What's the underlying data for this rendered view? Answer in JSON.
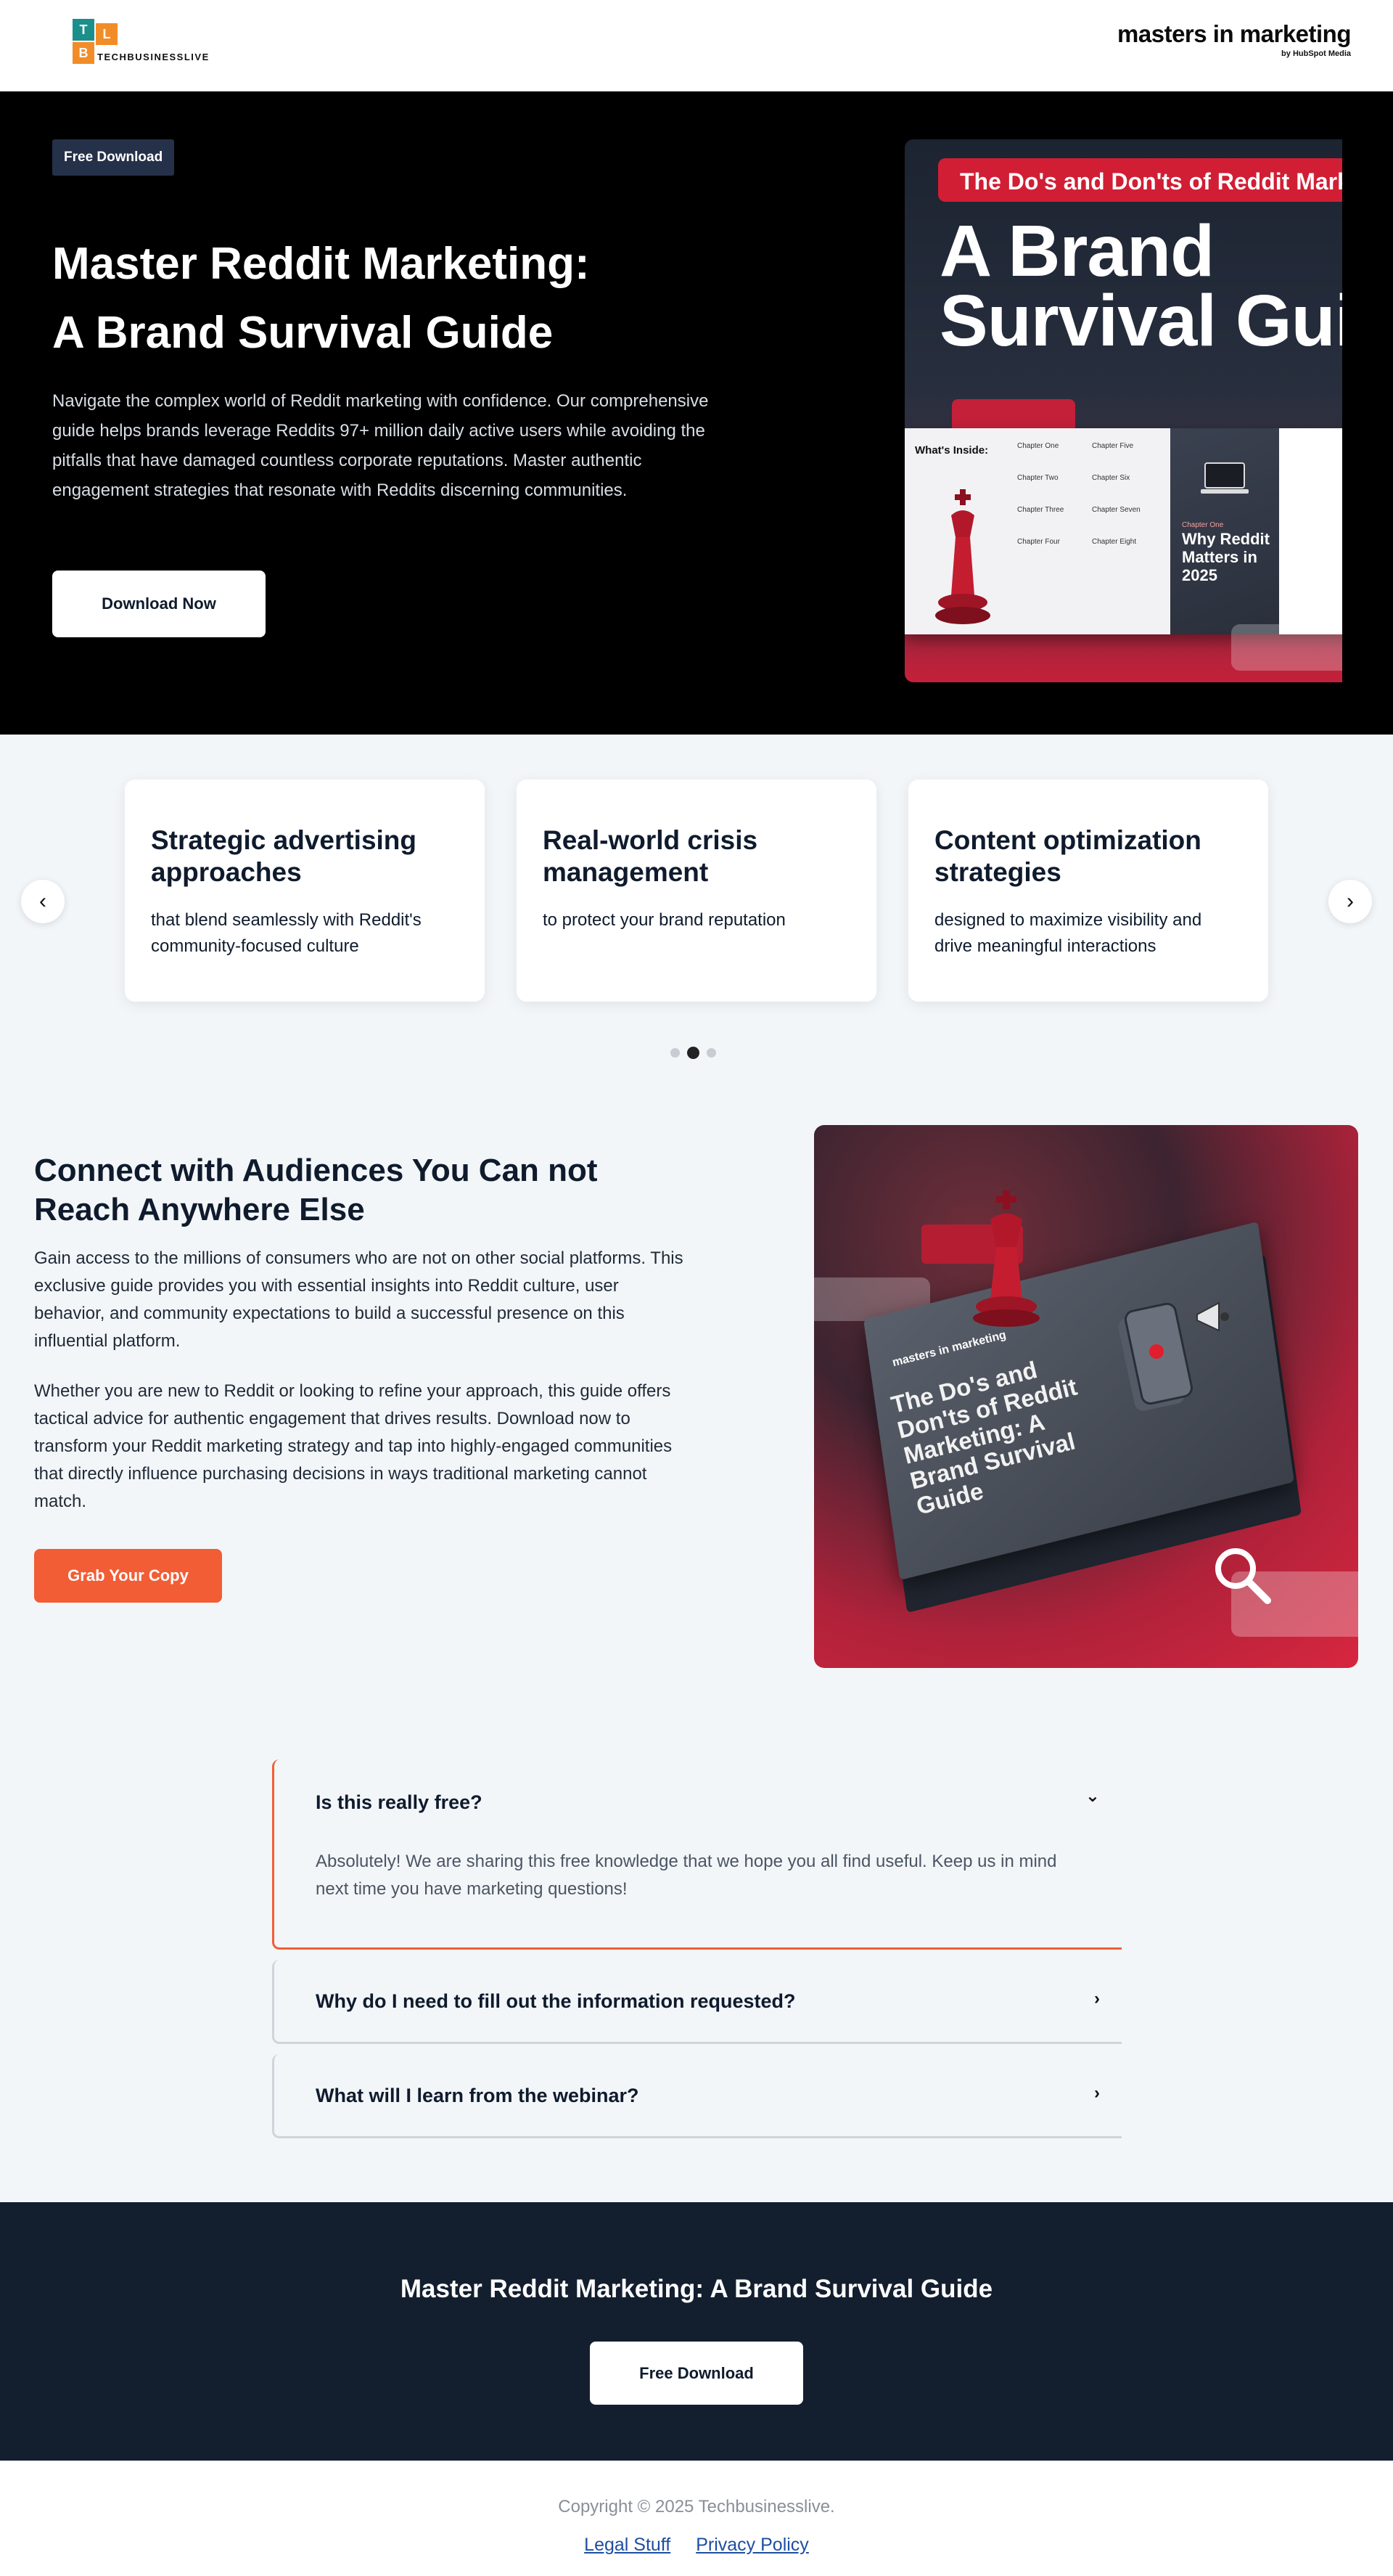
{
  "header": {
    "logo_letters": [
      "T",
      "L",
      "B"
    ],
    "logo_wordmark": "TECHBUSINESSLIVE",
    "partner_name": "masters in marketing",
    "partner_by": "by HubSpot Media"
  },
  "hero": {
    "badge": "Free Download",
    "title_line1": "Master Reddit Marketing:",
    "title_line2": "A Brand Survival Guide",
    "description": "Navigate the complex world of Reddit marketing with confidence. Our comprehensive guide helps brands leverage Reddits 97+ million daily active users while avoiding the pitfalls that have damaged countless corporate reputations. Master authentic engagement strategies that resonate with Reddits discerning communities.",
    "cta_label": "Download Now",
    "cover": {
      "pill": "The Do's and Don'ts of Reddit Marketing",
      "title_line1": "A Brand",
      "title_line2": "Survival Guide",
      "whats_inside": "What's Inside:",
      "chapters": [
        "Chapter One",
        "Chapter Two",
        "Chapter Three",
        "Chapter Four",
        "Chapter Five",
        "Chapter Six",
        "Chapter Seven",
        "Chapter Eight"
      ],
      "dark_chapter": "Chapter One",
      "dark_title": "Why Reddit Matters in 2025"
    }
  },
  "features": {
    "prev_label": "‹",
    "next_label": "›",
    "cards": [
      {
        "title": "Strategic advertising approaches",
        "text": "that blend seamlessly with Reddit's community-focused culture"
      },
      {
        "title": "Real-world crisis management",
        "text": "to protect your brand reputation"
      },
      {
        "title": "Content optimization strategies",
        "text": "designed to maximize visibility and drive meaningful interactions"
      }
    ],
    "active_dot": 1
  },
  "connect": {
    "title": "Connect with Audiences You Can not Reach Anywhere Else",
    "para1": "Gain access to the millions of consumers who are not on other social platforms. This exclusive guide provides you with essential insights into Reddit culture, user behavior, and community expectations to build a successful presence on this influential platform.",
    "para2": "Whether you are new to Reddit or looking to refine your approach, this guide offers tactical advice for authentic engagement that drives results. Download now to transform your Reddit marketing strategy and tap into highly-engaged communities that directly influence purchasing decisions in ways traditional marketing cannot match.",
    "cta_label": "Grab Your Copy",
    "book": {
      "brand": "masters in marketing",
      "title": "The Do's and Don'ts of Reddit Marketing: A Brand Survival Guide"
    }
  },
  "faq": [
    {
      "question": "Is this really free?",
      "answer": "Absolutely! We are sharing this free knowledge that we hope you all find useful. Keep us in mind next time you have marketing questions!",
      "icon": "⌄",
      "open": true
    },
    {
      "question": "Why do I need to fill out the information requested?",
      "icon": "›",
      "open": false
    },
    {
      "question": "What will I learn from the webinar?",
      "icon": "›",
      "open": false
    }
  ],
  "cta": {
    "title": "Master Reddit Marketing: A Brand Survival Guide",
    "button": "Free Download"
  },
  "footer": {
    "copyright": "Copyright © 2025 Techbusinesslive.",
    "links": [
      "Legal Stuff",
      "Privacy Policy"
    ]
  },
  "colors": {
    "accent_orange": "#f25d35",
    "navy": "#131f2f",
    "reddit_red": "#d11e35"
  }
}
